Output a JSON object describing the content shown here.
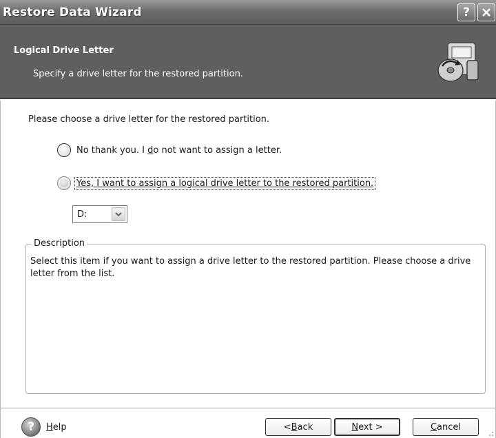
{
  "window": {
    "title": "Restore Data Wizard",
    "help_button": "?",
    "close_button": "X"
  },
  "header": {
    "title": "Logical Drive Letter",
    "subtitle": "Specify a drive letter for the restored partition.",
    "icon": "restore-wizard-icon"
  },
  "content": {
    "prompt": "Please choose a drive letter for the restored partition.",
    "options": [
      {
        "label_pre": "No thank you. I ",
        "label_accel": "d",
        "label_post": "o not want to assign a letter.",
        "selected": false
      },
      {
        "label_pre": "",
        "label_accel": "Y",
        "label_post": "es, I want to assign a logical drive letter to the restored partition.",
        "selected": true
      }
    ],
    "drive_select": {
      "value": "D:"
    },
    "description": {
      "legend": "Description",
      "text": "Select this item if you want to assign a drive letter to the restored partition. Please choose a drive letter from the list."
    }
  },
  "footer": {
    "help": {
      "accel": "H",
      "rest": "elp"
    },
    "back": {
      "pre": "< ",
      "accel": "B",
      "post": "ack"
    },
    "next": {
      "pre": "",
      "accel": "N",
      "post": "ext >"
    },
    "cancel": {
      "pre": "",
      "accel": "C",
      "post": "ancel"
    }
  },
  "colors": {
    "titlebar": "#6e6e6e",
    "header": "#5f5f5f",
    "background": "#ffffff"
  }
}
